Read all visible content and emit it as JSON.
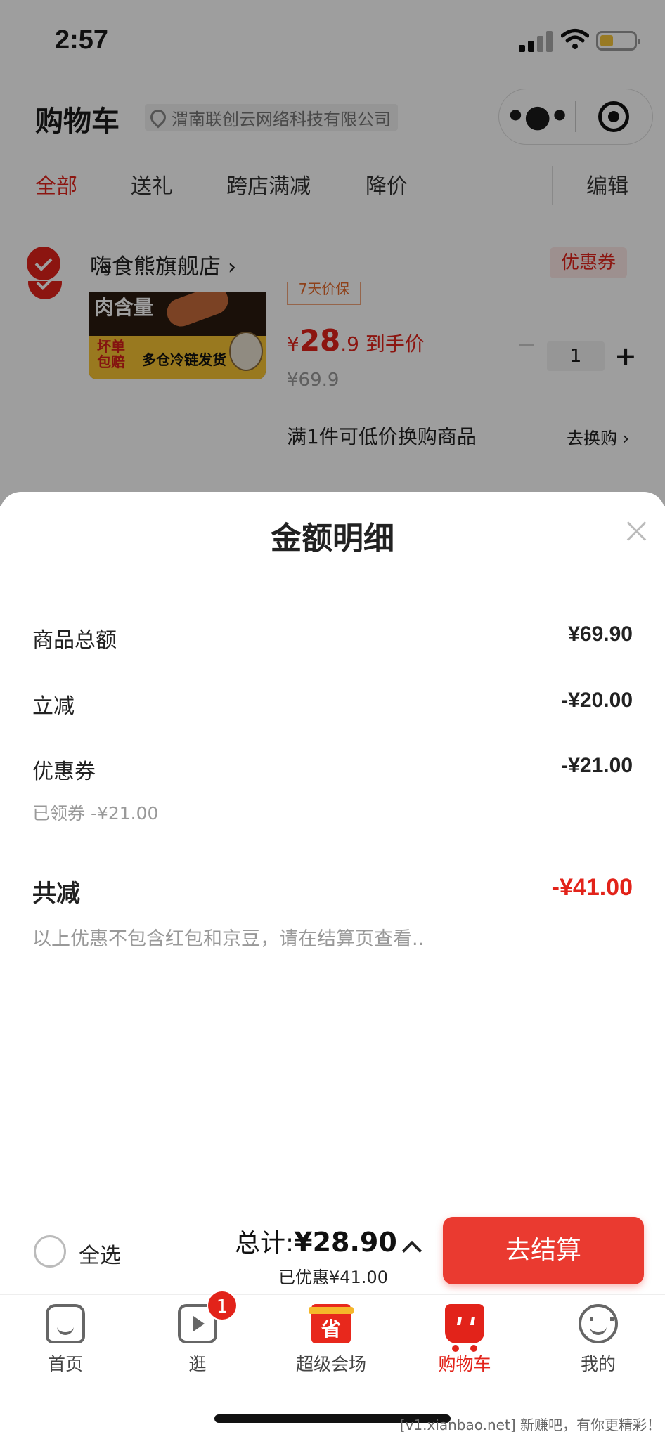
{
  "status_bar": {
    "time": "2:57"
  },
  "header": {
    "title": "购物车",
    "location": "渭南联创云网络科技有限公司",
    "capsule": {
      "menu_icon": "more-dots-icon",
      "close_icon": "target-icon"
    }
  },
  "tabs": [
    {
      "label": "全部",
      "active": true
    },
    {
      "label": "送礼"
    },
    {
      "label": "跨店满减"
    },
    {
      "label": "降价"
    }
  ],
  "edit_label": "编辑",
  "store": {
    "name": "嗨食熊旗舰店",
    "chevron": "›",
    "coupon_label": "优惠券"
  },
  "product": {
    "image_text_top": "肉含量",
    "image_text_red": "坏单包赔",
    "image_text_black": "多仓冷链发货",
    "tag": "7天价保",
    "price_symbol": "¥",
    "price_int": "28",
    "price_dec": ".9",
    "price_suffix": "到手价",
    "original_price": "¥69.9",
    "quantity": "1",
    "promo": "满1件可低价换购商品",
    "promo_link": "去换购 ›"
  },
  "sheet": {
    "title": "金额明细",
    "rows": [
      {
        "label": "商品总额",
        "value": "¥69.90"
      },
      {
        "label": "立减",
        "value": "-¥20.00"
      },
      {
        "label": "优惠券",
        "value": "-¥21.00",
        "note": "已领券 -¥21.00"
      }
    ],
    "total": {
      "label": "共减",
      "value": "-¥41.00"
    },
    "disclaimer": "以上优惠不包含红包和京豆，请在结算页查看.."
  },
  "checkout": {
    "select_all": "全选",
    "total_label": "总计:",
    "total_value": "¥28.90",
    "saved": "已优惠¥41.00",
    "button": "去结算"
  },
  "nav": [
    {
      "label": "首页",
      "icon": "home-icon"
    },
    {
      "label": "逛",
      "icon": "video-icon",
      "badge": "1"
    },
    {
      "label": "超级会场",
      "icon": "gift-icon",
      "icon_text": "省"
    },
    {
      "label": "购物车",
      "icon": "cart-icon",
      "active": true
    },
    {
      "label": "我的",
      "icon": "profile-icon"
    }
  ],
  "watermark": "[v1.xianbao.net] 新赚吧，有你更精彩！",
  "colors": {
    "accent": "#e2231a",
    "checkout_button": "#ea3a30"
  }
}
